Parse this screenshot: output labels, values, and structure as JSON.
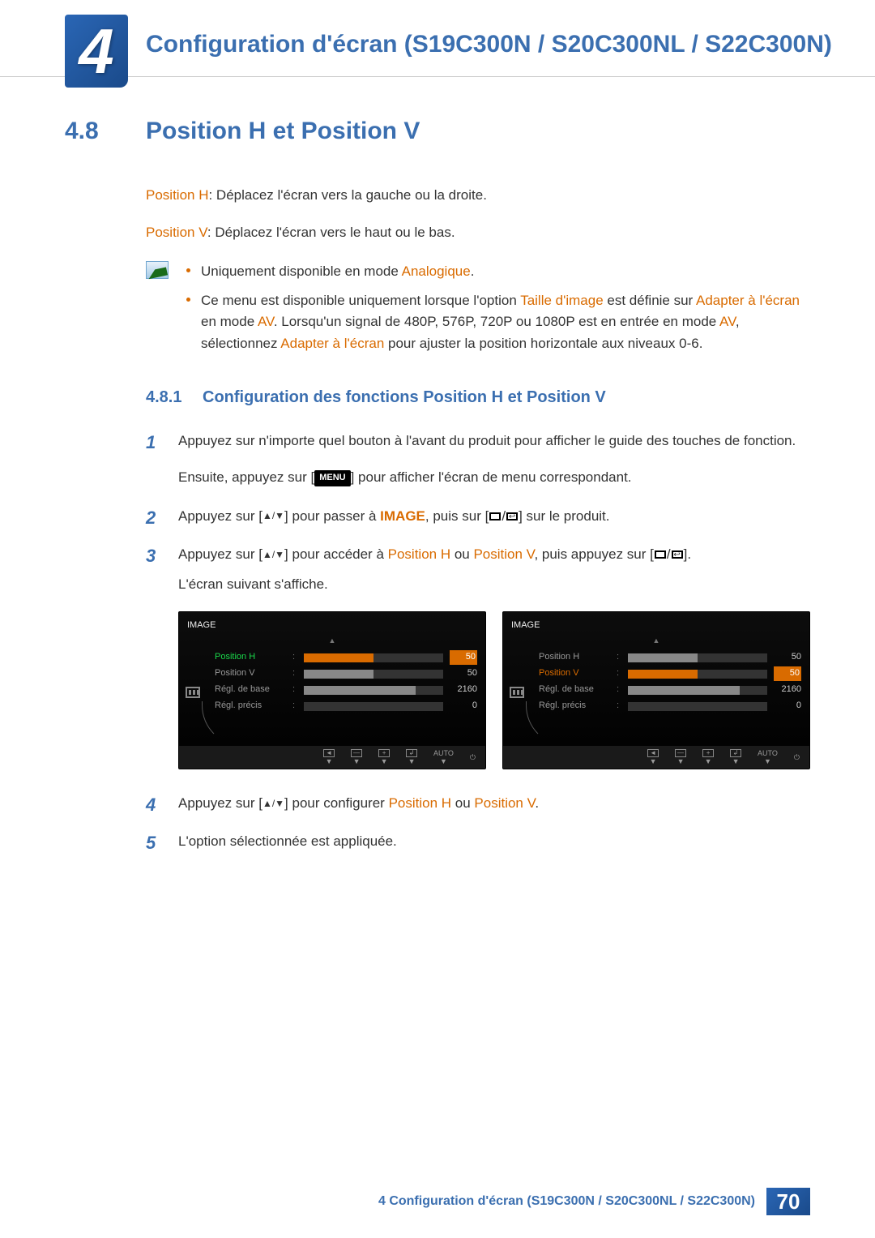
{
  "chapter": {
    "number": "4",
    "title": "Configuration d'écran (S19C300N / S20C300NL / S22C300N)"
  },
  "section": {
    "number": "4.8",
    "title": "Position H et Position V"
  },
  "intro": {
    "posH_label": "Position H",
    "posH_desc": ": Déplacez l'écran vers la gauche ou la droite.",
    "posV_label": "Position V",
    "posV_desc": ": Déplacez l'écran vers le haut ou le bas."
  },
  "notes": {
    "n1_pre": "Uniquement disponible en mode ",
    "n1_accent": "Analogique",
    "n1_post": ".",
    "n2_pre": "Ce menu est disponible uniquement lorsque l'option ",
    "n2_a1": "Taille d'image",
    "n2_mid1": " est définie sur ",
    "n2_a2": "Adapter à l'écran",
    "n2_mid2": " en mode ",
    "n2_a3": "AV",
    "n2_mid3": ". Lorsqu'un signal de 480P, 576P, 720P ou 1080P est en entrée en mode ",
    "n2_a4": "AV",
    "n2_mid4": ", sélectionnez ",
    "n2_a5": "Adapter à l'écran",
    "n2_post": " pour ajuster la position horizontale aux niveaux 0-6."
  },
  "subsection": {
    "number": "4.8.1",
    "title": "Configuration des fonctions Position H et Position V"
  },
  "steps": {
    "s1": "Appuyez sur n'importe quel bouton à l'avant du produit pour afficher le guide des touches de fonction.",
    "s1b_pre": "Ensuite, appuyez sur [",
    "s1b_menu": "MENU",
    "s1b_post": "] pour afficher l'écran de menu correspondant.",
    "s2_pre": "Appuyez sur [",
    "s2_mid1": "] pour passer à ",
    "s2_image": "IMAGE",
    "s2_mid2": ", puis sur [",
    "s2_post": "] sur le produit.",
    "s3_pre": "Appuyez sur [",
    "s3_mid1": "] pour accéder à ",
    "s3_ph": "Position H",
    "s3_ou": " ou ",
    "s3_pv": "Position V",
    "s3_mid2": ", puis appuyez sur [",
    "s3_post": "].",
    "s3_line2": "L'écran suivant s'affiche.",
    "s4_pre": "Appuyez sur [",
    "s4_mid": "] pour configurer ",
    "s4_ph": "Position H",
    "s4_ou": " ou ",
    "s4_pv": "Position V",
    "s4_post": ".",
    "s5": "L'option sélectionnée est appliquée."
  },
  "step_numbers": {
    "s1": "1",
    "s2": "2",
    "s3": "3",
    "s4": "4",
    "s5": "5"
  },
  "osd": {
    "title": "IMAGE",
    "auto": "AUTO",
    "items": [
      {
        "label": "Position H",
        "value": "50",
        "fill": 50
      },
      {
        "label": "Position V",
        "value": "50",
        "fill": 50
      },
      {
        "label": "Régl. de base",
        "value": "2160",
        "fill": 80
      },
      {
        "label": "Régl. précis",
        "value": "0",
        "fill": 0
      }
    ],
    "activeLeft": 0,
    "activeRight": 1
  },
  "footer": {
    "text": "4 Configuration d'écran (S19C300N / S20C300NL / S22C300N)",
    "page": "70"
  }
}
